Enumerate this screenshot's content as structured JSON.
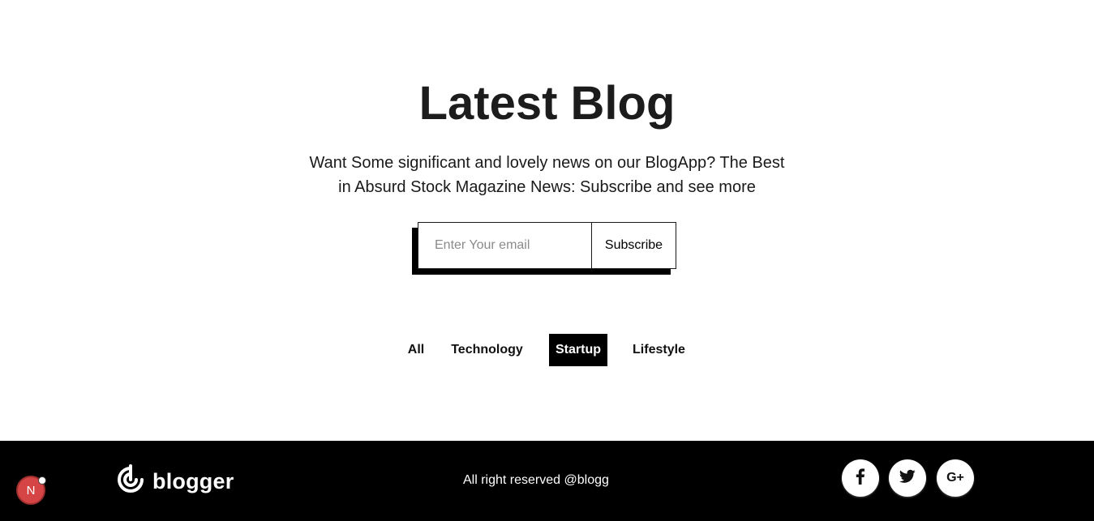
{
  "hero": {
    "title": "Latest Blog",
    "subtitle": "Want Some significant and lovely news on our BlogApp? The Best in Absurd Stock Magazine News: Subscribe and see more",
    "email_placeholder": "Enter Your email",
    "email_value": "",
    "subscribe_label": "Subscribe"
  },
  "filters": [
    {
      "label": "All",
      "active": false
    },
    {
      "label": "Technology",
      "active": false
    },
    {
      "label": "Startup",
      "active": true
    },
    {
      "label": "Lifestyle",
      "active": false
    }
  ],
  "footer": {
    "logo_text": "blogger",
    "logo_icon": "blogger-logo-icon",
    "copyright": "All right reserved @blogg",
    "social": [
      {
        "icon": "facebook-icon",
        "glyph": "f"
      },
      {
        "icon": "twitter-icon",
        "glyph": ""
      },
      {
        "icon": "google-plus-icon",
        "glyph": "G+"
      }
    ]
  },
  "badge": {
    "label": "N",
    "icon": "nextjs-dev-indicator-icon"
  },
  "colors": {
    "text": "#1a1a1a",
    "footer_bg": "#000000",
    "active_filter_bg": "#000000",
    "badge_bg": "#d64545"
  }
}
